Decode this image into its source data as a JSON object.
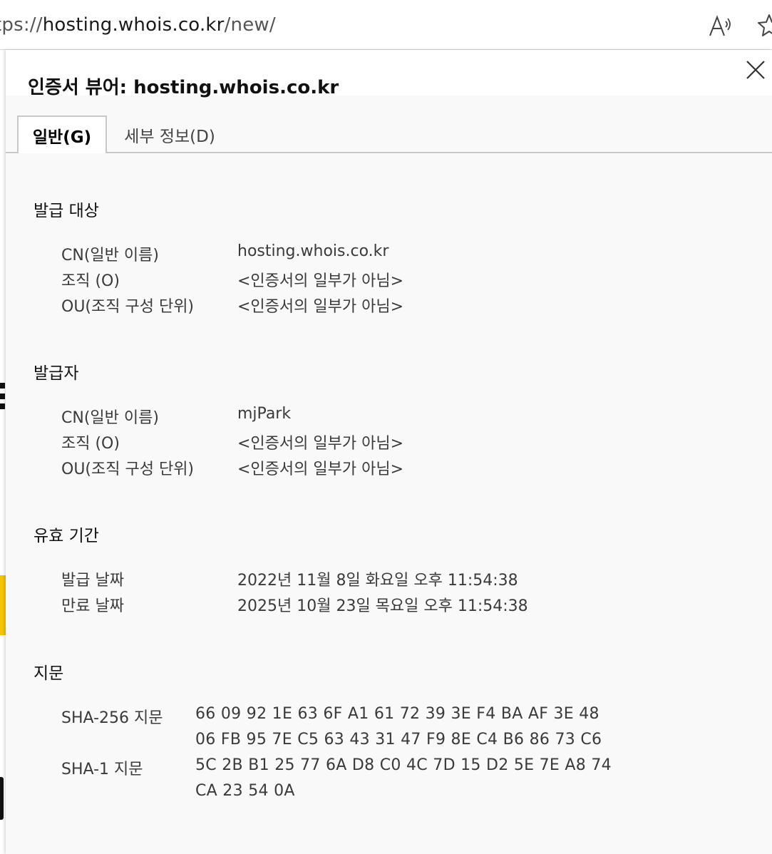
{
  "browser": {
    "url_prefix": "tps://",
    "url_host": "hosting.whois.co.kr",
    "url_path": "/new/"
  },
  "dialog": {
    "title": "인증서 뷰어: hosting.whois.co.kr",
    "tabs": [
      {
        "label": "일반(G)",
        "selected": true
      },
      {
        "label": "세부 정보(D)",
        "selected": false
      }
    ]
  },
  "issued_to": {
    "heading": "발급 대상",
    "rows": [
      {
        "label": "CN(일반 이름)",
        "value": "hosting.whois.co.kr"
      },
      {
        "label": "조직 (O)",
        "value": "<인증서의 일부가 아님>"
      },
      {
        "label": "OU(조직 구성 단위)",
        "value": "<인증서의 일부가 아님>"
      }
    ]
  },
  "issued_by": {
    "heading": "발급자",
    "rows": [
      {
        "label": "CN(일반 이름)",
        "value": "mjPark"
      },
      {
        "label": "조직 (O)",
        "value": "<인증서의 일부가 아님>"
      },
      {
        "label": "OU(조직 구성 단위)",
        "value": "<인증서의 일부가 아님>"
      }
    ]
  },
  "validity": {
    "heading": "유효 기간",
    "rows": [
      {
        "label": "발급 날짜",
        "value": "2022년 11월 8일 화요일 오후 11:54:38"
      },
      {
        "label": "만료 날짜",
        "value": "2025년 10월 23일 목요일 오후 11:54:38"
      }
    ]
  },
  "fingerprints": {
    "heading": "지문",
    "sha256": {
      "label": "SHA-256 지문",
      "line1": "66 09 92 1E 63 6F A1 61 72 39 3E F4 BA AF 3E 48",
      "line2": "06 FB 95 7E C5 63 43 31 47 F9 8E C4 B6 86 73 C6"
    },
    "sha1": {
      "label": "SHA-1 지문",
      "line1": "5C 2B B1 25 77 6A D8 C0 4C 7D 15 D2 5E 7E A8 74",
      "line2": "CA 23 54 0A"
    }
  },
  "icons": {
    "read_aloud": "read-aloud-icon",
    "favorite": "favorite-star-icon",
    "close": "close-icon"
  }
}
